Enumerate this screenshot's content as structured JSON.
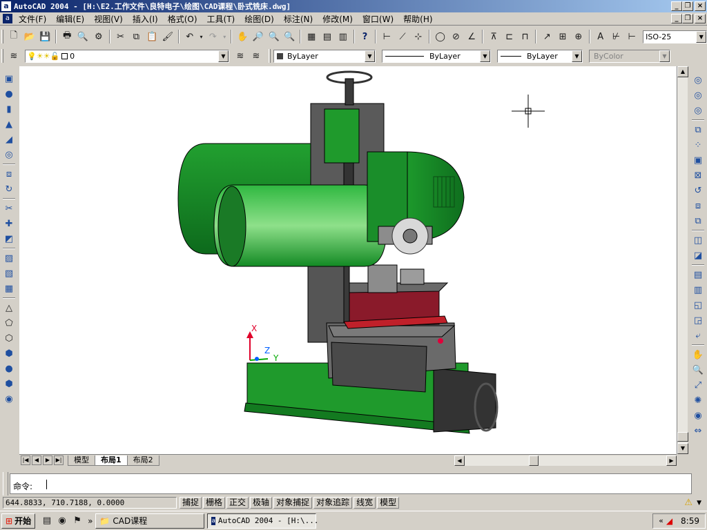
{
  "window": {
    "title": "AutoCAD 2004 - [H:\\E2.工作文件\\良特电子\\绘图\\CAD课程\\卧式铣床.dwg]",
    "app_icon": "a"
  },
  "menu": [
    "文件(F)",
    "编辑(E)",
    "视图(V)",
    "插入(I)",
    "格式(O)",
    "工具(T)",
    "绘图(D)",
    "标注(N)",
    "修改(M)",
    "窗口(W)",
    "帮助(H)"
  ],
  "toolbar": {
    "dimstyle": "ISO-25"
  },
  "properties": {
    "layer": "0",
    "color": "ByLayer",
    "linetype": "ByLayer",
    "lineweight": "ByLayer",
    "plotstyle": "ByColor"
  },
  "tabs": [
    "模型",
    "布局1",
    "布局2"
  ],
  "ucs": {
    "x": "X",
    "y": "Y",
    "z": "Z"
  },
  "command": {
    "prompt": "命令:"
  },
  "status": {
    "coords": "644.8833, 710.7188, 0.0000",
    "buttons": [
      "捕捉",
      "栅格",
      "正交",
      "极轴",
      "对象捕捉",
      "对象追踪",
      "线宽",
      "模型"
    ]
  },
  "taskbar": {
    "start": "开始",
    "folder": "CAD课程",
    "app": "AutoCAD 2004 - [H:\\...",
    "clock": "8:59"
  },
  "colors": {
    "machine_green": "#1fa030",
    "machine_gray": "#5a5a5a",
    "machine_red": "#8a1a2a",
    "titlebar": "#0a246a"
  }
}
